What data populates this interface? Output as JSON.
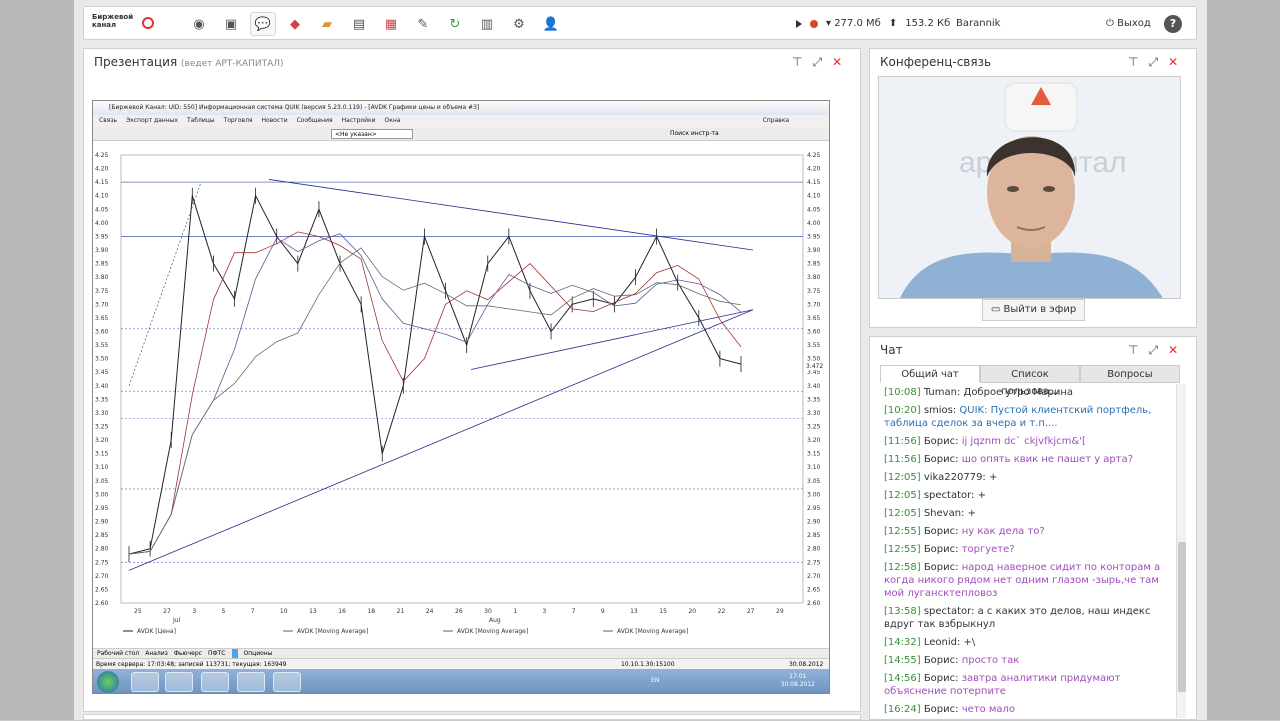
{
  "topbar": {
    "logo_text": "Биржевой канал",
    "download": "▾ 277.0 Мб",
    "upload": "153.2 Кб",
    "user": "Barannik",
    "exit_label": "Выход",
    "help": "?"
  },
  "presentation": {
    "title": "Презентация",
    "subtitle": "(ведет АРТ-КАПИТАЛ)"
  },
  "quik": {
    "window_title": "[Биржевой Канал: UID: 550] Информационная система QUIK (версия 5.23.0.119) - [AVDK Графики цены и объема #3]",
    "menu": [
      "Связь",
      "Экспорт данных",
      "Таблицы",
      "Торговля",
      "Новости",
      "Сообщения",
      "Настройки",
      "Окна"
    ],
    "help_menu": "Справка",
    "combo": "<Не указан>",
    "search_label": "Поиск инстр-та",
    "legend": [
      "AVDK [Цена]",
      "AVDK [Moving Average]",
      "AVDK [Moving Average]",
      "AVDK [Moving Average]"
    ],
    "tabs": [
      "Рабочий стол",
      "Анализ",
      "Фьючерс",
      "ПФТС",
      "",
      "Опционы"
    ],
    "status_left": "Время сервера: 17:03:48; записей 113731; текущая: 163949",
    "status_mid": "10.10.1.30:15100",
    "status_right": "30.08.2012",
    "lang": "EN",
    "clock_time": "17:01",
    "clock_date": "30.08.2012"
  },
  "chart_data": {
    "type": "line",
    "title": "",
    "yticks": [
      "4.25",
      "4.20",
      "4.15",
      "4.10",
      "4.05",
      "4.00",
      "3.95",
      "3.90",
      "3.85",
      "3.80",
      "3.75",
      "3.70",
      "3.65",
      "3.60",
      "3.55",
      "3.50",
      "3.45",
      "3.40",
      "3.35",
      "3.30",
      "3.25",
      "3.20",
      "3.15",
      "3.10",
      "3.05",
      "3.00",
      "2.95",
      "2.90",
      "2.85",
      "2.80",
      "2.75",
      "2.70",
      "2.65",
      "2.60"
    ],
    "ylim": [
      2.6,
      4.25
    ],
    "xticks": [
      "25",
      "27",
      "3",
      "5",
      "7",
      "10",
      "13",
      "16",
      "18",
      "21",
      "24",
      "26",
      "30",
      "1",
      "3",
      "7",
      "9",
      "13",
      "15",
      "20",
      "22",
      "27",
      "29"
    ],
    "month_labels": [
      "Jul",
      "Aug"
    ],
    "current_price": "3.472",
    "series": [
      {
        "name": "AVDK [Цена]",
        "values": [
          2.78,
          2.8,
          3.2,
          4.1,
          3.85,
          3.72,
          4.1,
          3.95,
          3.85,
          4.05,
          3.85,
          3.7,
          3.15,
          3.4,
          3.95,
          3.75,
          3.55,
          3.85,
          3.95,
          3.75,
          3.6,
          3.7,
          3.72,
          3.7,
          3.8,
          3.95,
          3.78,
          3.65,
          3.5,
          3.48
        ]
      }
    ]
  },
  "conference": {
    "title": "Конференц-связь",
    "onair_label": "Выйти в эфир",
    "backdrop_text": "арт-капитал"
  },
  "chat": {
    "title": "Чат",
    "tabs": [
      "Общий чат",
      "Список пользова...",
      "Вопросы"
    ],
    "messages": [
      {
        "time": "[10:08]",
        "name": "Tuman:",
        "text": "Доброе утро Марина"
      },
      {
        "time": "[10:20]",
        "name": "smios:",
        "text": "QUIK: Пустой клиентский портфель, таблица сделок за вчера и т.п...."
      },
      {
        "time": "[11:56]",
        "name": "Борис:",
        "text": "ij jqznm dc` ckjvfkjcm&'["
      },
      {
        "time": "[11:56]",
        "name": "Борис:",
        "text": "шо опять квик не пашет у арта?"
      },
      {
        "time": "[12:05]",
        "name": "vika220779:",
        "text": "+"
      },
      {
        "time": "[12:05]",
        "name": "spectator:",
        "text": "+"
      },
      {
        "time": "[12:05]",
        "name": "Shevan:",
        "text": "+"
      },
      {
        "time": "[12:55]",
        "name": "Борис:",
        "text": "ну как дела то?"
      },
      {
        "time": "[12:55]",
        "name": "Борис:",
        "text": "торгуете?"
      },
      {
        "time": "[12:58]",
        "name": "Борис:",
        "text": "народ наверное сидит по конторам а когда никого рядом нет одним глазом -зырь,че там мой лугансктепловоз"
      },
      {
        "time": "[13:58]",
        "name": "spectator:",
        "text": "а с каких это делов, наш индекс вдруг так взбрыкнул"
      },
      {
        "time": "[14:32]",
        "name": "Leonid:",
        "text": "+\\"
      },
      {
        "time": "[14:55]",
        "name": "Борис:",
        "text": "просто так"
      },
      {
        "time": "[14:56]",
        "name": "Борис:",
        "text": "завтра аналитики придумают объяснение потерпите"
      },
      {
        "time": "[16:24]",
        "name": "Борис:",
        "text": "чето мало"
      }
    ]
  },
  "colors": {
    "accent": "#d33",
    "chat_name": "#a04dbb",
    "chat_time": "#3a8f3a",
    "chart_line": "#2a2a8c"
  },
  "icons": [
    "user-icon",
    "presentation-icon",
    "chat-bubble-icon",
    "share-icon",
    "folder-icon",
    "document-icon",
    "mixer-icon",
    "edit-icon",
    "refresh-icon",
    "layout-icon",
    "gear-icon",
    "add-user-icon"
  ]
}
